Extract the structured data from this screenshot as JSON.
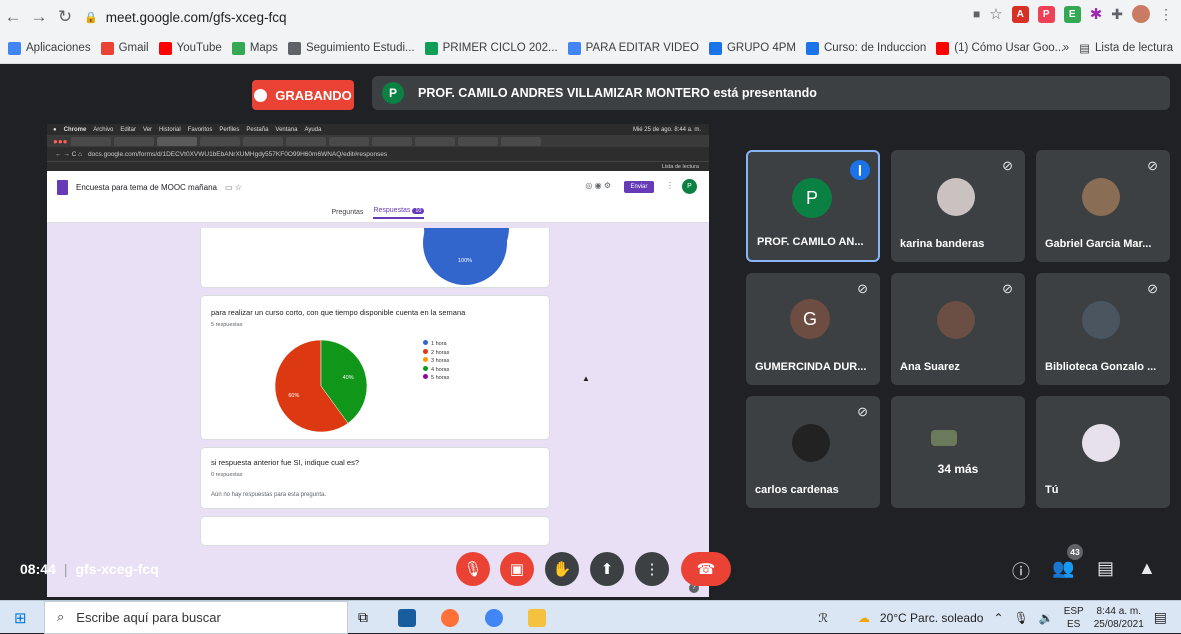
{
  "browser": {
    "url": "meet.google.com/gfs-xceg-fcq",
    "bookmarks": [
      {
        "label": "Aplicaciones",
        "color": "#4285f4"
      },
      {
        "label": "Gmail",
        "color": "#ea4335"
      },
      {
        "label": "YouTube",
        "color": "#ff0000"
      },
      {
        "label": "Maps",
        "color": "#34a853"
      },
      {
        "label": "Seguimiento Estudi...",
        "color": "#5f6368"
      },
      {
        "label": "PRIMER CICLO 202...",
        "color": "#0f9d58"
      },
      {
        "label": "PARA EDITAR VIDEO",
        "color": "#4285f4"
      },
      {
        "label": "GRUPO 4PM",
        "color": "#1a73e8"
      },
      {
        "label": "Curso: de Induccion",
        "color": "#1a73e8"
      },
      {
        "label": "(1) Cómo Usar Goo...",
        "color": "#ff0000"
      }
    ],
    "reading_list": "Lista de lectura",
    "more_bookmarks": "»"
  },
  "meet": {
    "recording_label": "GRABANDO",
    "presenter_initial": "P",
    "presenting_text": "PROF. CAMILO ANDRES VILLAMIZAR MONTERO está presentando",
    "time": "08:44",
    "meeting_code": "gfs-xceg-fcq",
    "participant_count": "43",
    "participants": [
      {
        "name": "PROF. CAMILO AN...",
        "initial": "P",
        "avatar_color": "#0b8043",
        "active": true
      },
      {
        "name": "karina banderas",
        "photo_color": "#c9c2c0"
      },
      {
        "name": "Gabriel Garcia Mar...",
        "photo_color": "#8a6d55"
      },
      {
        "name": "GUMERCINDA DUR...",
        "initial": "G",
        "avatar_color": "#6d4c41"
      },
      {
        "name": "Ana Suarez",
        "photo_color": "#6b4f45"
      },
      {
        "name": "Biblioteca Gonzalo ...",
        "photo_color": "#4b5560"
      },
      {
        "name": "carlos cardenas",
        "photo_color": "#222222"
      },
      {
        "name": "34 más",
        "photo_color": "#6b7a5a"
      },
      {
        "name": "Tú",
        "photo_color": "#e6e1ea"
      }
    ]
  },
  "shared_screen": {
    "mac_menu": [
      "Chrome",
      "Archivo",
      "Editar",
      "Ver",
      "Historial",
      "Favoritos",
      "Perfiles",
      "Pestaña",
      "Ventana",
      "Ayuda"
    ],
    "mac_clock": "Mié 25 de ago. 8:44 a. m.",
    "url": "docs.google.com/forms/d/1DECVt0XVWU1bEbANrXUMHgdy557KF0O99H60m6WNAQ/edit#responses",
    "reading_list": "Lista de lectura",
    "form_title": "Encuesta para tema de MOOC mañana",
    "send_label": "Enviar",
    "user_initial": "P",
    "tab_questions": "Preguntas",
    "tab_responses": "Respuestas",
    "responses_count": "10",
    "card1_pie_label": "100%",
    "card2_question": "para realizar un curso corto, con que tiempo disponible cuenta en la semana",
    "card2_responses": "5 respuestas",
    "card3_question": "si respuesta anterior fue SI, indique cual es?",
    "card3_responses": "0 respuestas",
    "card3_empty": "Aún no hay respuestas para esta pregunta."
  },
  "chart_data": {
    "type": "pie",
    "categories": [
      "1 hora",
      "2 horas",
      "3 horas",
      "4 horas",
      "5 horas"
    ],
    "values": [
      0,
      60,
      0,
      40,
      0
    ],
    "colors": [
      "#3366cc",
      "#dc3912",
      "#ff9900",
      "#109618",
      "#990099"
    ],
    "data_labels": [
      "40%",
      "60%"
    ]
  },
  "taskbar": {
    "search_placeholder": "Escribe aquí para buscar",
    "weather": "20°C  Parc. soleado",
    "language_top": "ESP",
    "language_bottom": "ES",
    "time": "8:44 a. m.",
    "date": "25/08/2021"
  }
}
